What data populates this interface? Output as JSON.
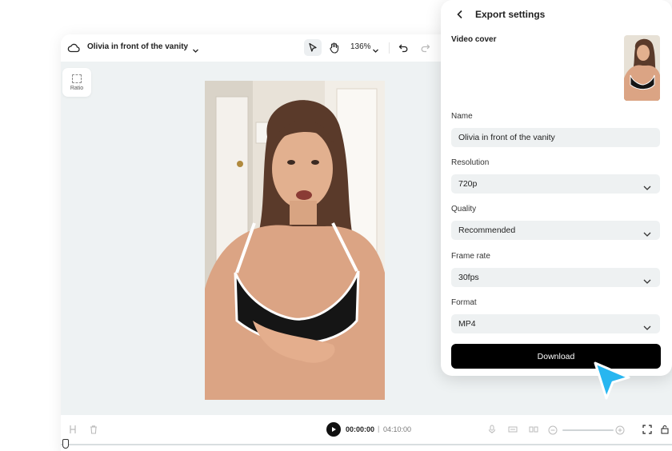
{
  "editor": {
    "project_title": "Olivia in front of the vanity",
    "zoom_label": "136%",
    "ratio_label": "Ratio"
  },
  "playback": {
    "current_time": "00:00:00",
    "separator": "|",
    "total_time": "04:10:00"
  },
  "export_panel": {
    "title": "Export settings",
    "video_cover_label": "Video cover",
    "fields": {
      "name": {
        "label": "Name",
        "value": "Olivia in front of the vanity"
      },
      "resolution": {
        "label": "Resolution",
        "value": "720p"
      },
      "quality": {
        "label": "Quality",
        "value": "Recommended"
      },
      "frame_rate": {
        "label": "Frame rate",
        "value": "30fps"
      },
      "format": {
        "label": "Format",
        "value": "MP4"
      }
    },
    "download_label": "Download"
  },
  "colors": {
    "accent_cursor": "#27b6f0",
    "canvas_bg": "#eef2f3",
    "download_bg": "#000000"
  },
  "icons": [
    "cloud-icon",
    "chevron-down-icon",
    "pointer-tool-icon",
    "hand-tool-icon",
    "undo-icon",
    "redo-icon",
    "ratio-icon",
    "split-icon",
    "trash-icon",
    "play-icon",
    "mic-icon",
    "caption-icon",
    "split-scene-icon",
    "zoom-out-icon",
    "zoom-in-icon",
    "fullscreen-icon",
    "lock-icon",
    "back-arrow-icon",
    "cursor-arrow-icon"
  ]
}
